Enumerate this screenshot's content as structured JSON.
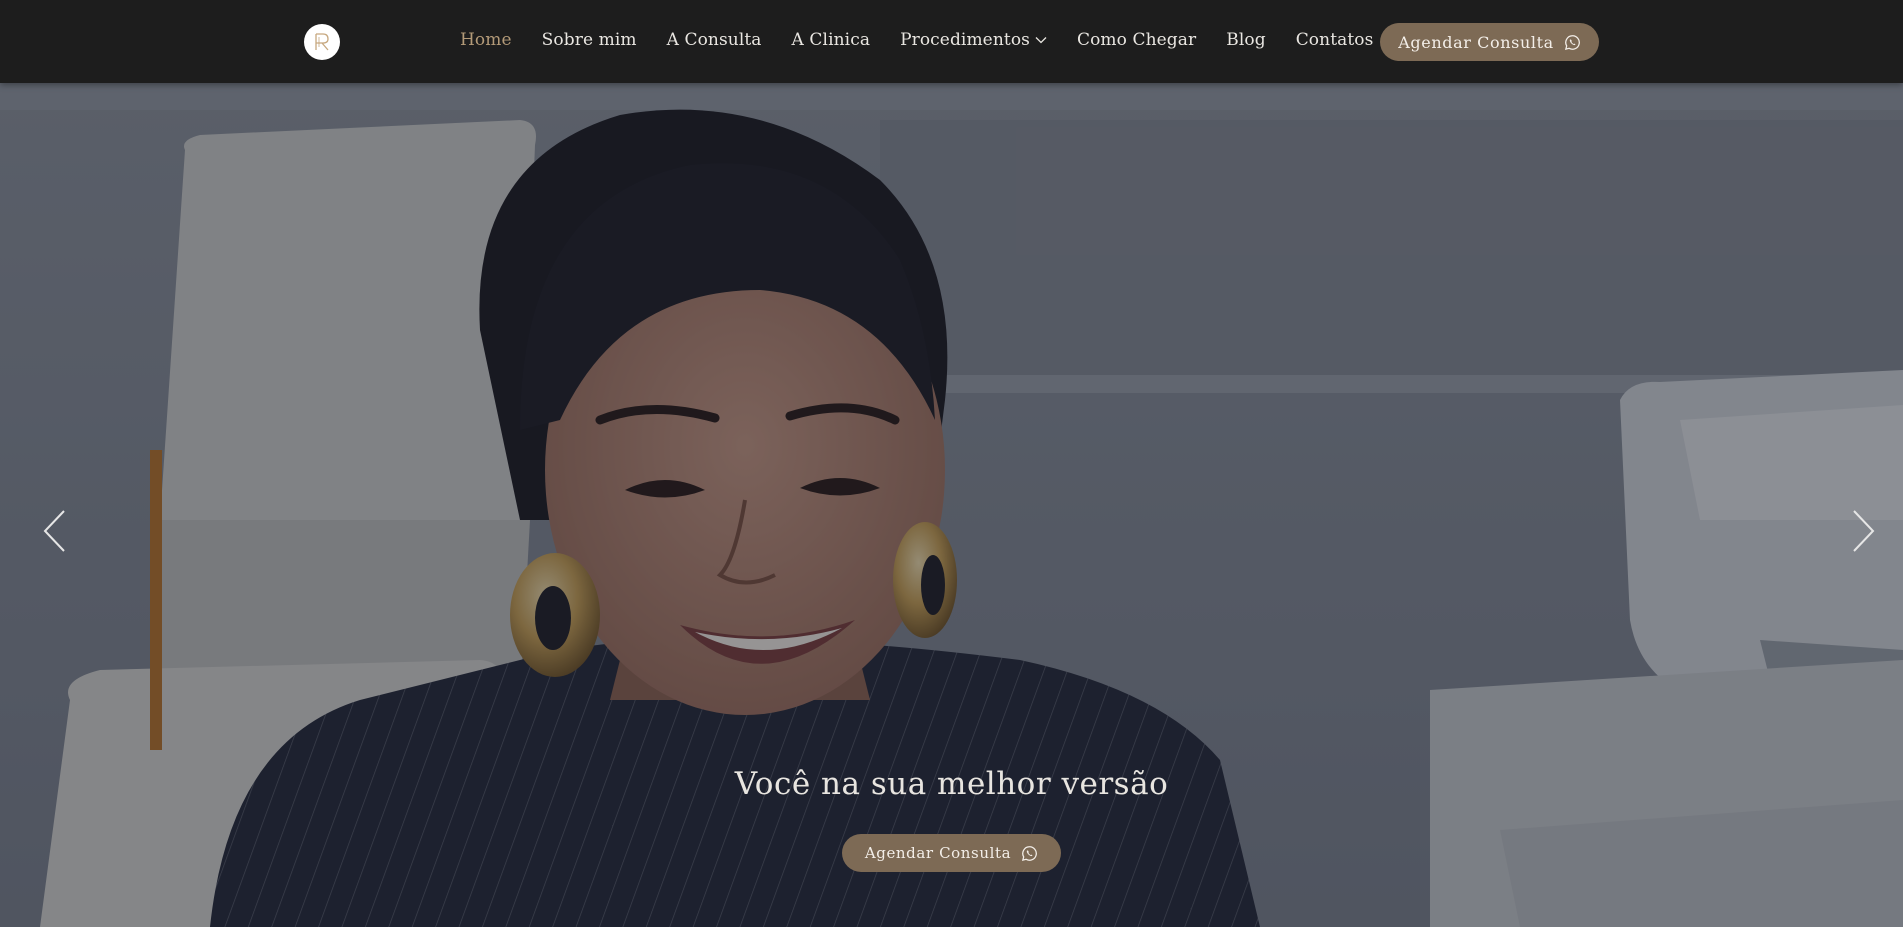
{
  "navbar": {
    "logo_letter": "R",
    "items": [
      {
        "label": "Home",
        "active": true
      },
      {
        "label": "Sobre mim"
      },
      {
        "label": "A Consulta"
      },
      {
        "label": "A Clinica"
      },
      {
        "label": "Procedimentos",
        "has_dropdown": true
      },
      {
        "label": "Como Chegar"
      },
      {
        "label": "Blog"
      },
      {
        "label": "Contatos"
      }
    ],
    "cta_label": "Agendar Consulta",
    "cta_icon": "whatsapp-icon"
  },
  "hero": {
    "headline": "Você na sua melhor versão",
    "cta_label": "Agendar Consulta",
    "cta_icon": "whatsapp-icon",
    "prev_icon": "chevron-left-icon",
    "next_icon": "chevron-right-icon"
  },
  "colors": {
    "navbar_bg": "#1d1d1d",
    "accent": "#7d6a55",
    "active_nav": "#b39a78",
    "nav_text": "#e9e6e1"
  }
}
